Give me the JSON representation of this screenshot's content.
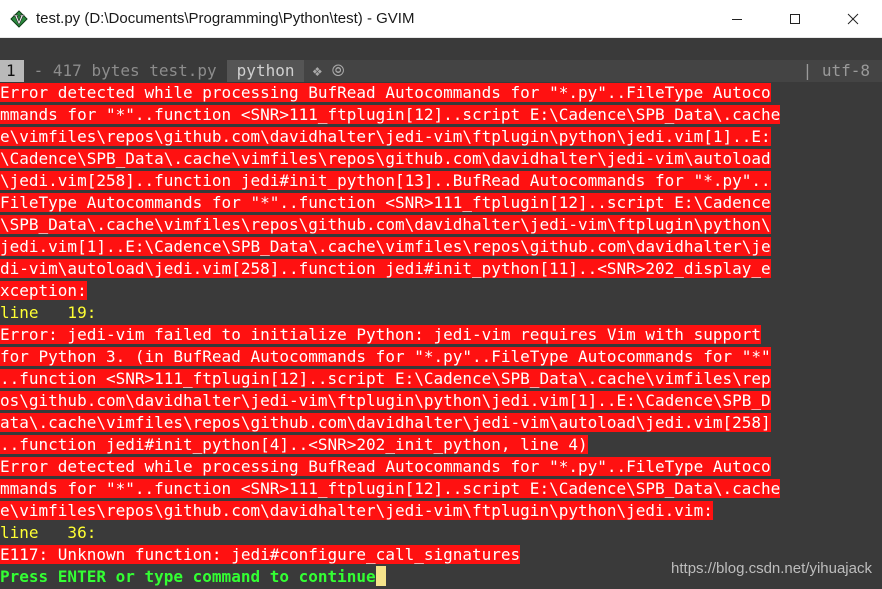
{
  "window": {
    "title": "test.py (D:\\Documents\\Programming\\Python\\test) - GVIM",
    "icon": "vim-icon"
  },
  "statusline": {
    "line_number": "1",
    "file_info": "- 417 bytes test.py",
    "filetype": "python",
    "icons": "❖ ⦾",
    "encoding": "| utf-8"
  },
  "messages": [
    {
      "type": "error",
      "text": "Error detected while processing BufRead Autocommands for \"*.py\"..FileType Autoco"
    },
    {
      "type": "error",
      "text": "mmands for \"*\"..function <SNR>111_ftplugin[12]..script E:\\Cadence\\SPB_Data\\.cache"
    },
    {
      "type": "error",
      "text": "e\\vimfiles\\repos\\github.com\\davidhalter\\jedi-vim\\ftplugin\\python\\jedi.vim[1]..E:"
    },
    {
      "type": "error",
      "text": "\\Cadence\\SPB_Data\\.cache\\vimfiles\\repos\\github.com\\davidhalter\\jedi-vim\\autoload"
    },
    {
      "type": "error",
      "text": "\\jedi.vim[258]..function jedi#init_python[13]..BufRead Autocommands for \"*.py\".."
    },
    {
      "type": "error",
      "text": "FileType Autocommands for \"*\"..function <SNR>111_ftplugin[12]..script E:\\Cadence"
    },
    {
      "type": "error",
      "text": "\\SPB_Data\\.cache\\vimfiles\\repos\\github.com\\davidhalter\\jedi-vim\\ftplugin\\python\\"
    },
    {
      "type": "error",
      "text": "jedi.vim[1]..E:\\Cadence\\SPB_Data\\.cache\\vimfiles\\repos\\github.com\\davidhalter\\je"
    },
    {
      "type": "error",
      "text": "di-vim\\autoload\\jedi.vim[258]..function jedi#init_python[11]..<SNR>202_display_e"
    },
    {
      "type": "error",
      "text": "xception:"
    },
    {
      "type": "linenr",
      "text": "line   19:"
    },
    {
      "type": "error",
      "text": "Error: jedi-vim failed to initialize Python: jedi-vim requires Vim with support"
    },
    {
      "type": "error",
      "text": "for Python 3. (in BufRead Autocommands for \"*.py\"..FileType Autocommands for \"*\""
    },
    {
      "type": "error",
      "text": "..function <SNR>111_ftplugin[12]..script E:\\Cadence\\SPB_Data\\.cache\\vimfiles\\rep"
    },
    {
      "type": "error",
      "text": "os\\github.com\\davidhalter\\jedi-vim\\ftplugin\\python\\jedi.vim[1]..E:\\Cadence\\SPB_D"
    },
    {
      "type": "error",
      "text": "ata\\.cache\\vimfiles\\repos\\github.com\\davidhalter\\jedi-vim\\autoload\\jedi.vim[258]"
    },
    {
      "type": "error",
      "text": "..function jedi#init_python[4]..<SNR>202_init_python, line 4)"
    },
    {
      "type": "error",
      "text": "Error detected while processing BufRead Autocommands for \"*.py\"..FileType Autoco"
    },
    {
      "type": "error",
      "text": "mmands for \"*\"..function <SNR>111_ftplugin[12]..script E:\\Cadence\\SPB_Data\\.cache"
    },
    {
      "type": "error",
      "text": "e\\vimfiles\\repos\\github.com\\davidhalter\\jedi-vim\\ftplugin\\python\\jedi.vim:"
    },
    {
      "type": "linenr",
      "text": "line   36:"
    },
    {
      "type": "error",
      "text": "E117: Unknown function: jedi#configure_call_signatures"
    },
    {
      "type": "prompt",
      "text": "Press ENTER or type command to continue"
    }
  ],
  "watermark": "https://blog.csdn.net/yihuajack",
  "colors": {
    "error_bg": "#ff1111",
    "linenr_fg": "#ffff33",
    "prompt_fg": "#33ff33",
    "cursor": "#f5e38a"
  }
}
